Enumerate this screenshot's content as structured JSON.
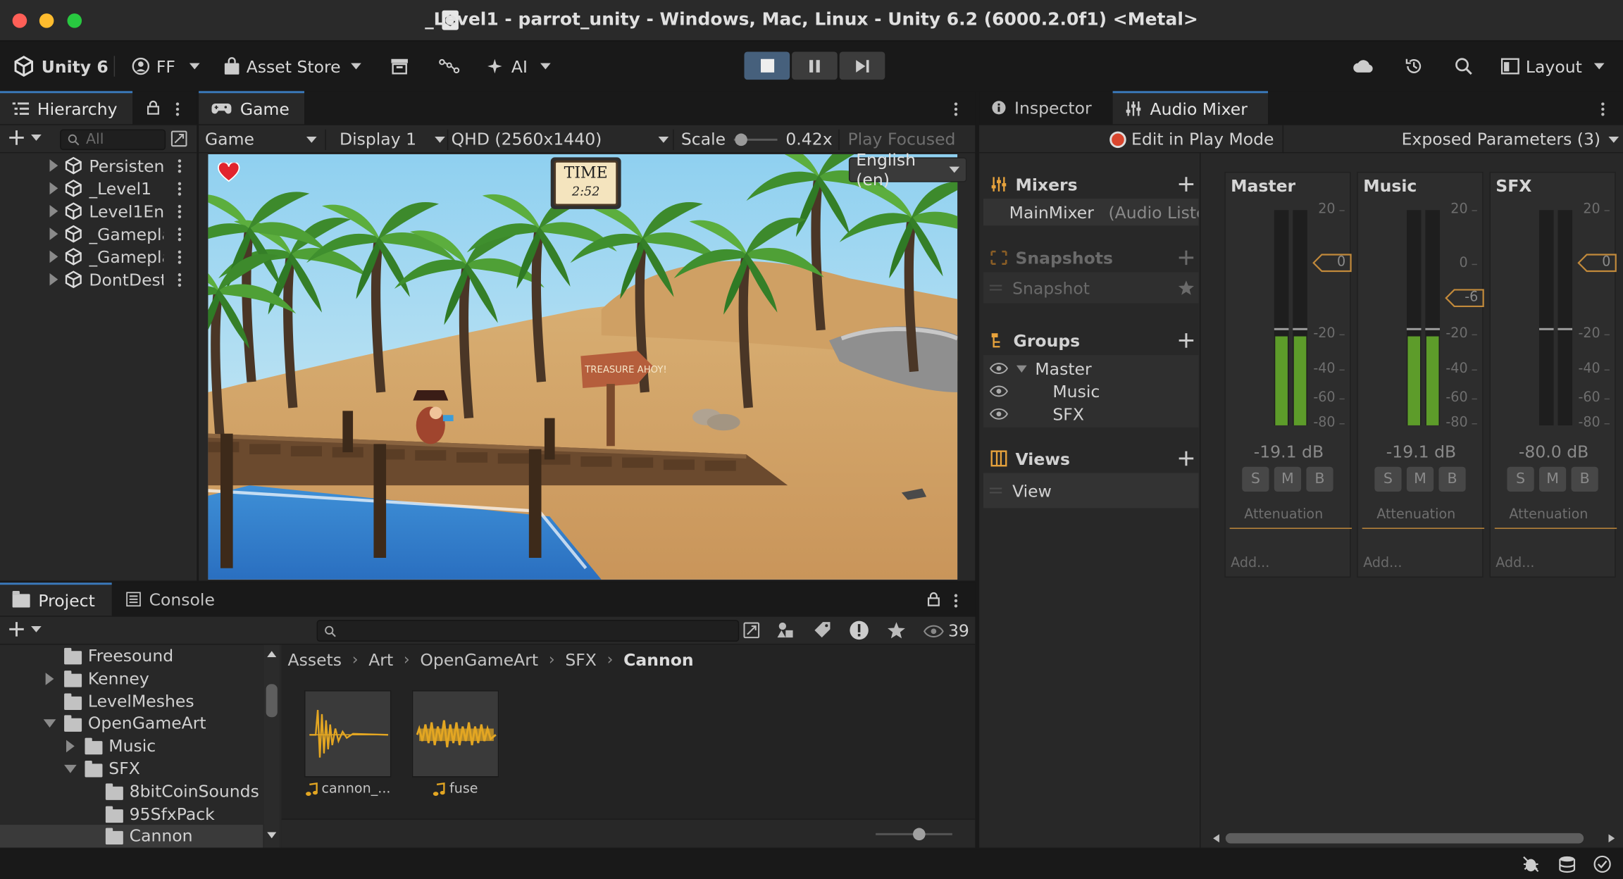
{
  "window": {
    "title": "_Level1 - parrot_unity - Windows, Mac, Linux - Unity 6.2 (6000.2.0f1) <Metal>"
  },
  "toolbar": {
    "unity_label": "Unity 6",
    "account_label": "FF",
    "asset_store_label": "Asset Store",
    "ai_label": "AI",
    "layout_label": "Layout"
  },
  "hierarchy": {
    "tab_label": "Hierarchy",
    "search_placeholder": "All",
    "items": [
      {
        "label": "Persisten"
      },
      {
        "label": "_Level1"
      },
      {
        "label": "Level1En"
      },
      {
        "label": "_Gamepla"
      },
      {
        "label": "_Gamepla"
      },
      {
        "label": "DontDest"
      }
    ]
  },
  "game": {
    "tab_label": "Game",
    "view_select": "Game",
    "display_select": "Display 1",
    "resolution_select": "QHD (2560x1440)",
    "scale_label": "Scale",
    "scale_value": "0.42x",
    "play_focused": "Play Focused",
    "language_select": "English (en)",
    "time_label": "TIME",
    "time_value": "2:52",
    "sign_text": "TREASURE AHOY!"
  },
  "inspector": {
    "tab_label": "Inspector"
  },
  "audio_mixer": {
    "tab_label": "Audio Mixer",
    "edit_play_mode": "Edit in Play Mode",
    "exposed_params": "Exposed Parameters (3)",
    "mixers_header": "Mixers",
    "mixer_name": "MainMixer",
    "mixer_suffix": "(Audio Liste",
    "snapshots_header": "Snapshots",
    "snapshot_name": "Snapshot",
    "groups_header": "Groups",
    "groups": [
      {
        "label": "Master"
      },
      {
        "label": "Music"
      },
      {
        "label": "SFX"
      }
    ],
    "views_header": "Views",
    "view_name": "View",
    "scale_labels": [
      "20",
      "0",
      "-20",
      "-40",
      "-60",
      "-80"
    ],
    "strips": [
      {
        "name": "Master",
        "db": "-19.1 dB",
        "fader": "0",
        "level": 0.45,
        "effect": "Attenuation",
        "add": "Add..."
      },
      {
        "name": "Music",
        "db": "-19.1 dB",
        "fader": "-6",
        "level": 0.45,
        "effect": "Attenuation",
        "add": "Add..."
      },
      {
        "name": "SFX",
        "db": "-80.0 dB",
        "fader": "0",
        "level": 0.0,
        "effect": "Attenuation",
        "add": "Add..."
      }
    ],
    "solo_label": "S",
    "mute_label": "M",
    "bypass_label": "B"
  },
  "project": {
    "tab_label": "Project",
    "console_tab_label": "Console",
    "search_placeholder": "",
    "hidden_count": "39",
    "tree": [
      {
        "label": "Freesound",
        "indent": 0,
        "arrow": "none"
      },
      {
        "label": "Kenney",
        "indent": 0,
        "arrow": "right"
      },
      {
        "label": "LevelMeshes",
        "indent": 0,
        "arrow": "none"
      },
      {
        "label": "OpenGameArt",
        "indent": 0,
        "arrow": "down"
      },
      {
        "label": "Music",
        "indent": 1,
        "arrow": "right"
      },
      {
        "label": "SFX",
        "indent": 1,
        "arrow": "down"
      },
      {
        "label": "8bitCoinSounds",
        "indent": 2,
        "arrow": "none"
      },
      {
        "label": "95SfxPack",
        "indent": 2,
        "arrow": "none"
      },
      {
        "label": "Cannon",
        "indent": 2,
        "arrow": "none"
      }
    ],
    "breadcrumb": [
      "Assets",
      "Art",
      "OpenGameArt",
      "SFX",
      "Cannon"
    ],
    "assets": [
      {
        "label": "cannon_..."
      },
      {
        "label": "fuse"
      }
    ]
  },
  "colors": {
    "accent_blue": "#3a79bb",
    "meter_green": "#5d9c2a",
    "fader_orange": "#c28a3b",
    "record_red": "#d9462e",
    "waveform": "#e3a622"
  }
}
